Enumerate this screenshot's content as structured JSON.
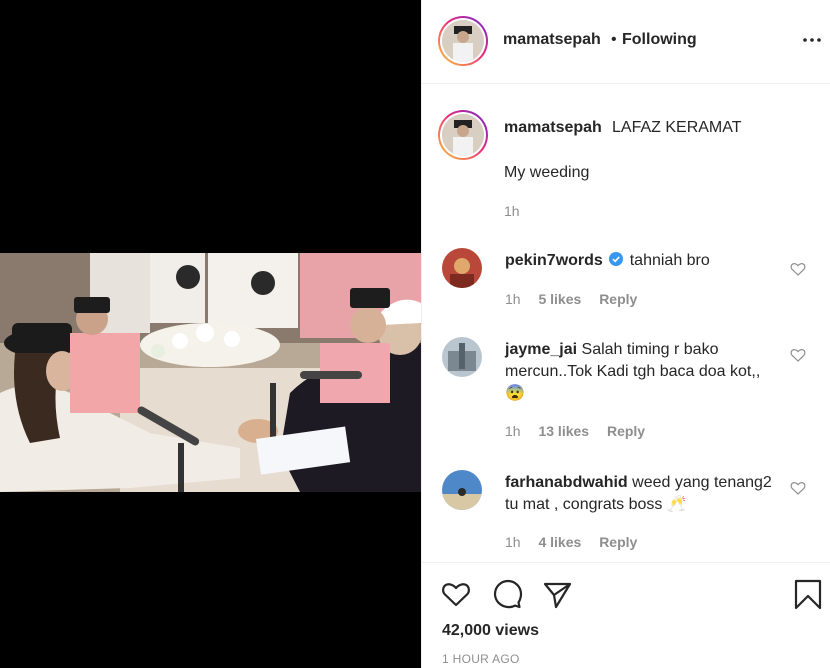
{
  "post": {
    "username": "mamatsepah",
    "separator": "•",
    "follow_status": "Following",
    "more_icon": "more-horizontal-icon"
  },
  "caption": {
    "username": "mamatsepah",
    "text": "LAFAZ KERAMAT",
    "line2": "My weeding",
    "time": "1h"
  },
  "comments": [
    {
      "username": "pekin7words",
      "verified": true,
      "text": "tahniah bro",
      "time": "1h",
      "likes": "5 likes",
      "reply": "Reply"
    },
    {
      "username": "jayme_jai",
      "verified": false,
      "text": "Salah timing r bako mercun..Tok Kadi tgh baca doa kot,,😨",
      "time": "1h",
      "likes": "13 likes",
      "reply": "Reply"
    },
    {
      "username": "farhanabdwahid",
      "verified": false,
      "text": "weed yang tenang2 tu mat , congrats boss 🥂",
      "time": "1h",
      "likes": "4 likes",
      "reply": "Reply"
    }
  ],
  "actions": {
    "views": "42,000 views",
    "time_ago": "1 HOUR AGO"
  },
  "colors": {
    "text": "#262626",
    "secondary": "#8e8e8e",
    "verified": "#3897f0",
    "border": "#efefef"
  }
}
